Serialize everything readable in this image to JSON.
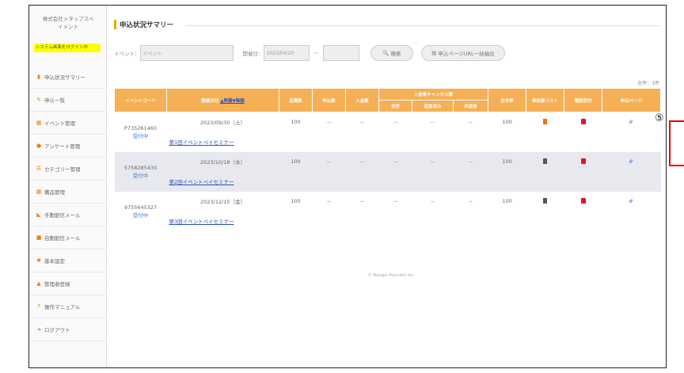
{
  "sidebar": {
    "company_line1": "株式会社メタップスペ",
    "company_line2": "イメント",
    "system_badge": "システム画面をログイン中",
    "items": [
      {
        "label": "申込状況サマリー",
        "icon": "chart-icon",
        "color": "#f08010"
      },
      {
        "label": "申込一覧",
        "icon": "pen-icon",
        "color": "#f08010"
      },
      {
        "label": "イベント管理",
        "icon": "grid-icon",
        "color": "#f08010"
      },
      {
        "label": "アンケート管理",
        "icon": "gear-icon",
        "color": "#f08010"
      },
      {
        "label": "カテゴリー管理",
        "icon": "list-icon",
        "color": "#f08010"
      },
      {
        "label": "備品管理",
        "icon": "grid-icon",
        "color": "#f08010"
      },
      {
        "label": "手動配信メール",
        "icon": "rss-icon",
        "color": "#f08010"
      },
      {
        "label": "自動配信メール",
        "icon": "mail-icon",
        "color": "#f08010"
      },
      {
        "label": "基本設定",
        "icon": "cogs-icon",
        "color": "#f08010"
      },
      {
        "label": "管理者登録",
        "icon": "user-icon",
        "color": "#f08010"
      },
      {
        "label": "操作マニュアル",
        "icon": "help-icon",
        "color": "#f08010"
      },
      {
        "label": "ログアウト",
        "icon": "logout-icon",
        "color": "#f08010"
      }
    ]
  },
  "page": {
    "title": "申込状況サマリー",
    "count": "全件：3件"
  },
  "search": {
    "event_label": "イベント：",
    "event_placeholder": "イベント",
    "date_label": "開催日：",
    "date_from": "2023/04/20",
    "tilde": "~",
    "date_to": "",
    "search_button": "検索",
    "url_button": "申込ページURL一括抽出"
  },
  "table": {
    "headers": {
      "event_code": "イベントコード",
      "date": "開催日付 ",
      "date_asc": "▲昇順",
      "date_desc": "▼降順",
      "capacity": "定員数",
      "applications": "申込数",
      "payments": "入金数",
      "cancel_group": "入金後キャンセル数",
      "cancel_all": "全件",
      "cancel_refunded": "返金済み",
      "cancel_unrefunded": "未返金",
      "vacancy": "空き枠",
      "participants": "参加者リスト",
      "phone": "電話受付",
      "app_page": "申込ページ"
    },
    "rows": [
      {
        "code": "P735261460",
        "status": "受付中",
        "date": "2023/09/30（土）",
        "event_name": "第1回イベントペイセミナー",
        "capacity": "100",
        "applications": "--",
        "payments": "--",
        "cancel_all": "--",
        "cancel_refunded": "--",
        "cancel_unrefunded": "--",
        "vacancy": "100"
      },
      {
        "code": "5758285430",
        "status": "受付中",
        "date": "2023/10/18（水）",
        "event_name": "第2回イベントペイセミナー",
        "capacity": "100",
        "applications": "--",
        "payments": "--",
        "cancel_all": "--",
        "cancel_refunded": "--",
        "cancel_unrefunded": "--",
        "vacancy": "100"
      },
      {
        "code": "9755645327",
        "status": "受付中",
        "date": "2023/12/15（金）",
        "event_name": "第3回イベントペイセミナー",
        "capacity": "100",
        "applications": "--",
        "payments": "--",
        "cancel_all": "--",
        "cancel_refunded": "--",
        "cancel_unrefunded": "--",
        "vacancy": "100"
      }
    ]
  },
  "annotation": {
    "number": "⑤"
  },
  "footer": "© Metaps Payment inc."
}
